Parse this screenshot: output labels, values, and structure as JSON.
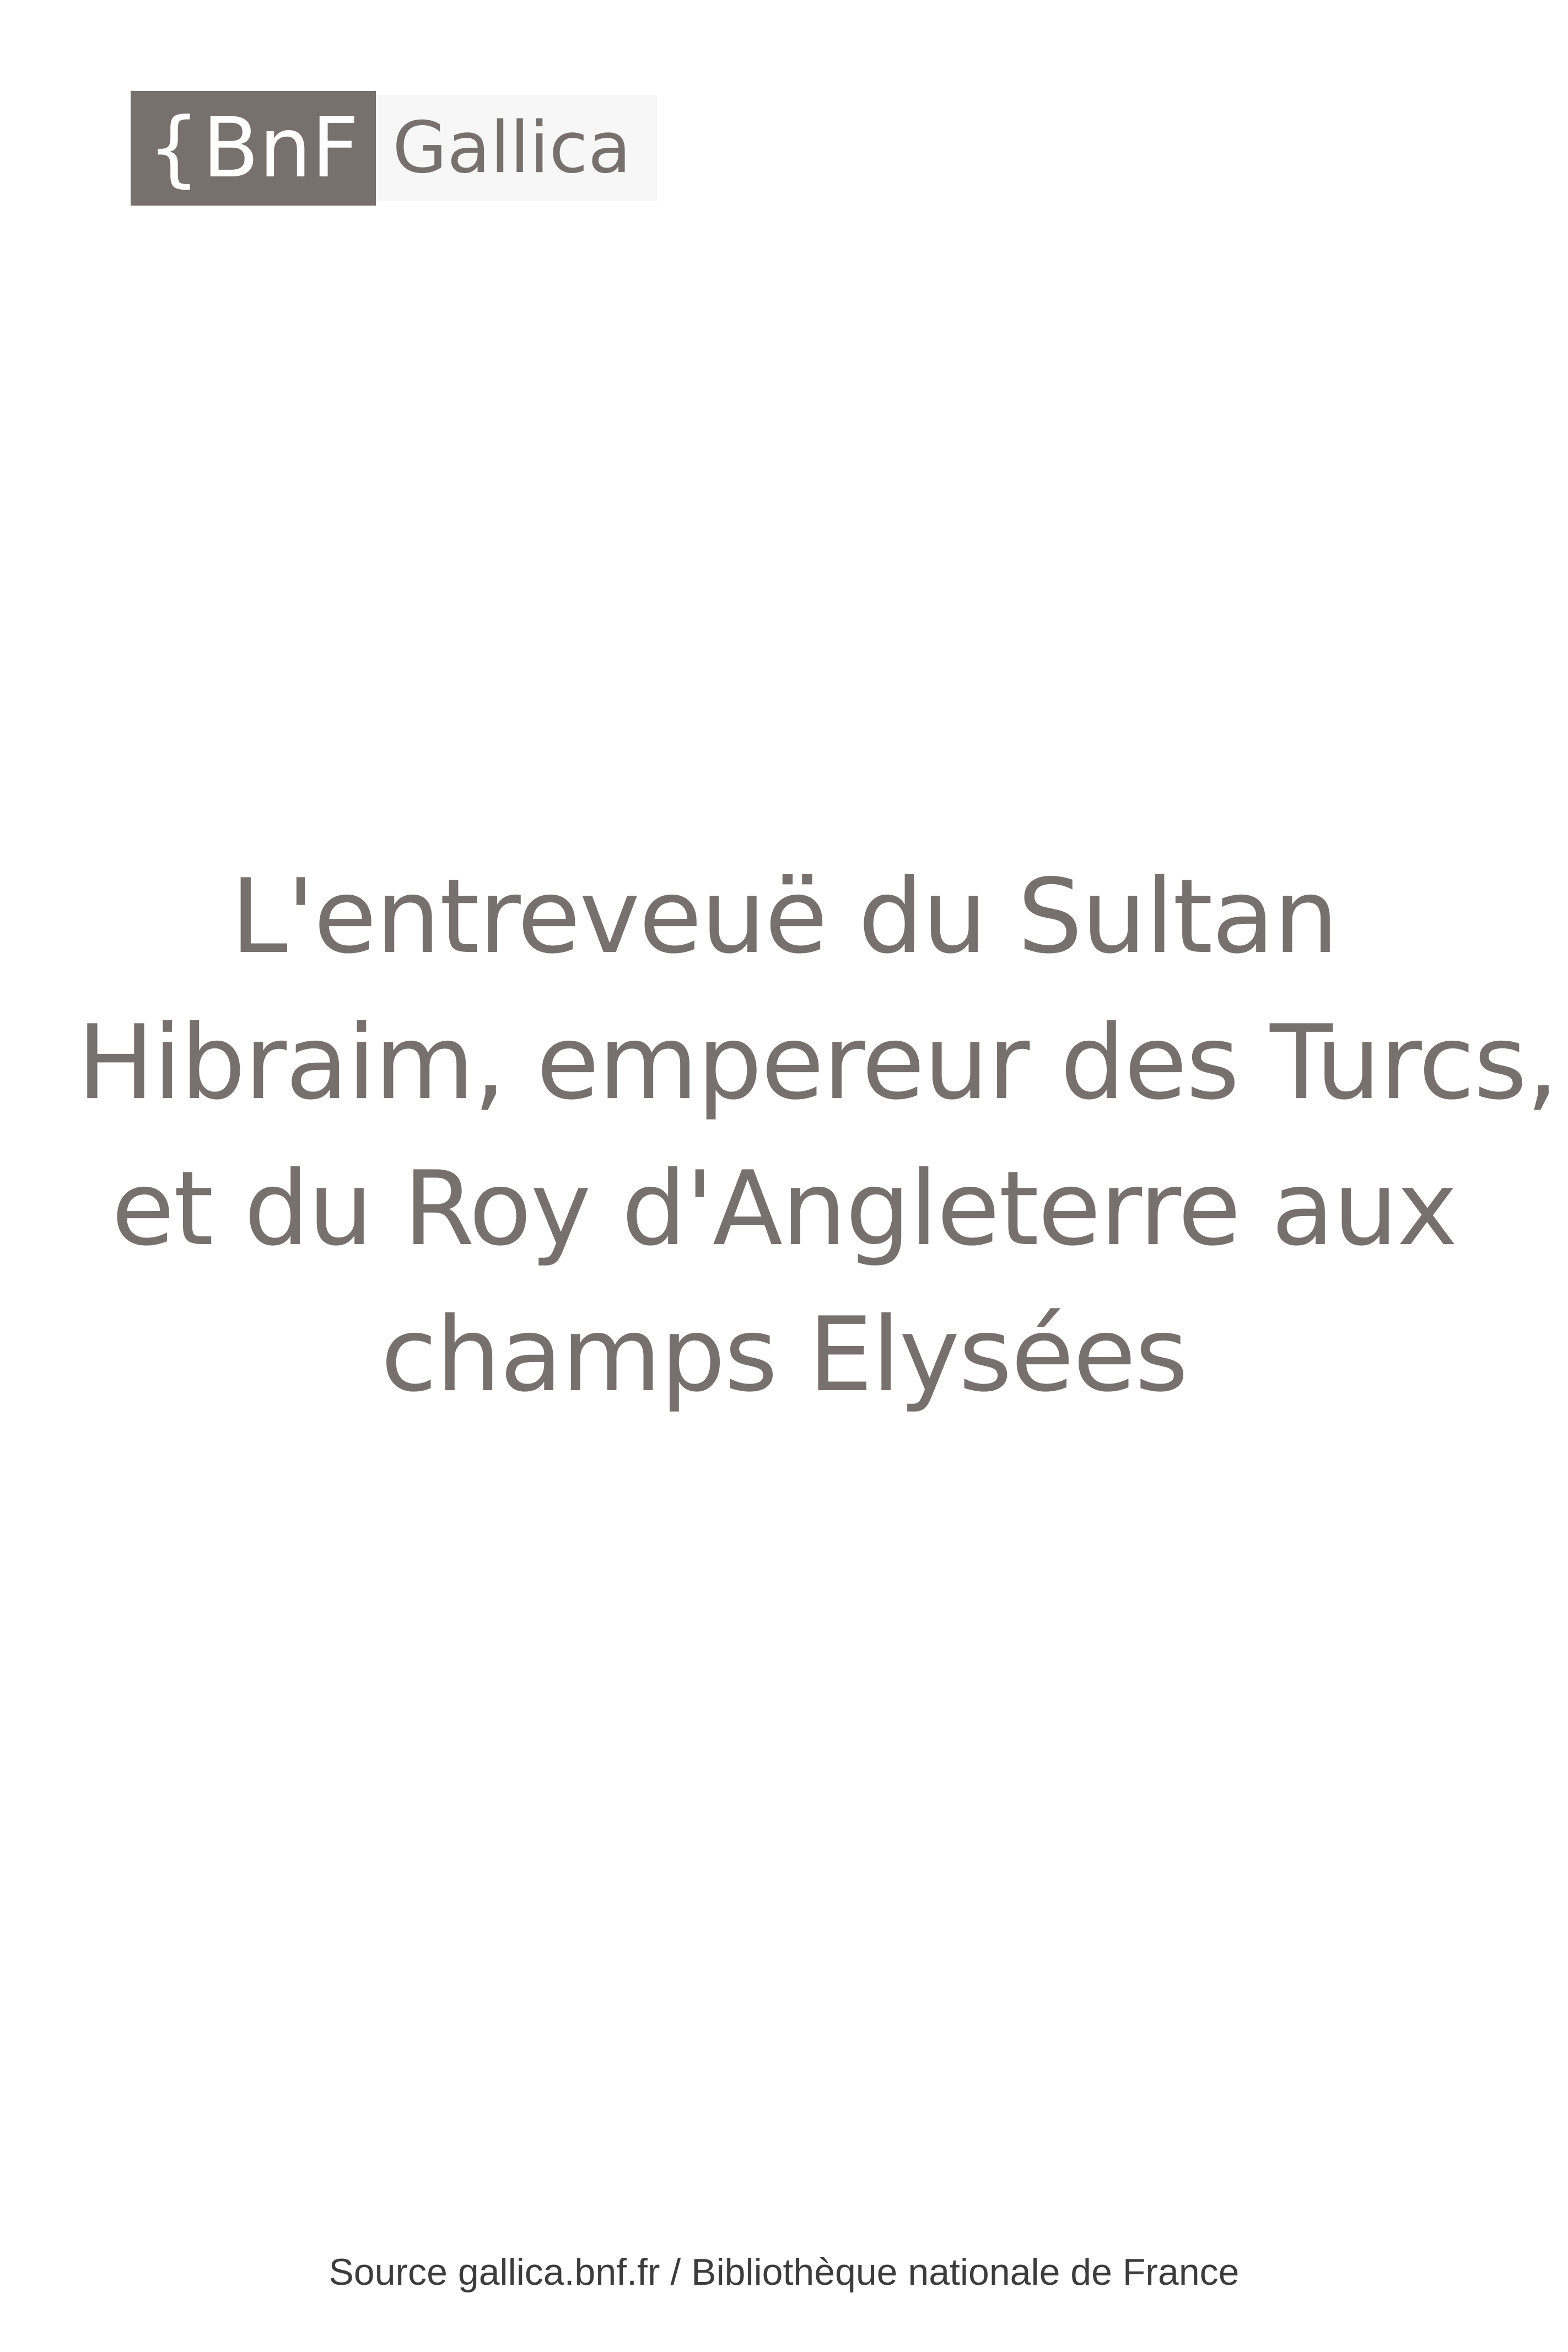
{
  "logo": {
    "bnf": "BnF",
    "brace": "{",
    "gallica": "Gallica"
  },
  "title": {
    "lines": [
      "L'entreveuë du Sultan",
      "Hibraim, empereur des Turcs,",
      "et du Roy d'Angleterre aux",
      "champs Elysées"
    ]
  },
  "footer": {
    "source": "Source gallica.bnf.fr / Bibliothèque nationale de France"
  },
  "colors": {
    "brand_gray": "#78706d",
    "footer_text": "#3c3c3c"
  }
}
